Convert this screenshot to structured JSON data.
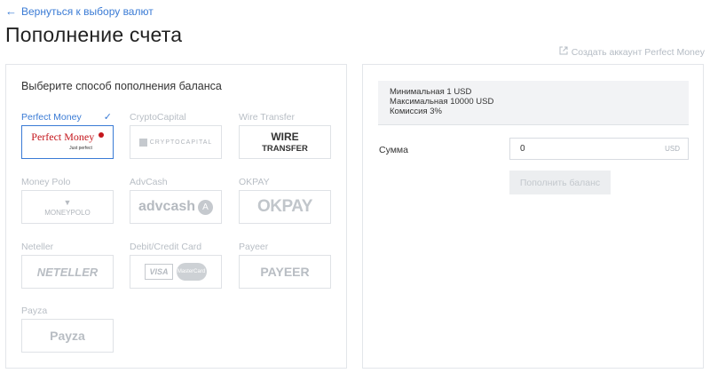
{
  "header": {
    "back_label": "Вернуться к выбору валют",
    "title": "Пополнение счета",
    "create_account_label": "Создать аккаунт Perfect Money"
  },
  "methods_panel": {
    "heading": "Выберите способ пополнения баланса",
    "methods": [
      {
        "label": "Perfect Money",
        "logo_text": "Perfect Money",
        "logo_sub": "Just perfect",
        "selected": true,
        "icon": "check-icon"
      },
      {
        "label": "CryptoCapital",
        "logo_text": "CRYPTOCAPITAL",
        "selected": false
      },
      {
        "label": "Wire Transfer",
        "logo_text": "WIRE",
        "logo_sub": "TRANSFER",
        "selected": false
      },
      {
        "label": "Money Polo",
        "logo_text": "MONEYPOLO",
        "selected": false
      },
      {
        "label": "AdvCash",
        "logo_text": "advcash",
        "selected": false
      },
      {
        "label": "OKPAY",
        "logo_text": "OKPAY",
        "selected": false
      },
      {
        "label": "Neteller",
        "logo_text": "NETELLER",
        "selected": false
      },
      {
        "label": "Debit/Credit Card",
        "logo_text": "VISA",
        "logo_sub": "MasterCard",
        "selected": false
      },
      {
        "label": "Payeer",
        "logo_text": "PAYEER",
        "selected": false
      },
      {
        "label": "Payza",
        "logo_text": "Payza",
        "selected": false
      }
    ]
  },
  "deposit_panel": {
    "info": {
      "min": "Минимальная 1 USD",
      "max": "Максимальная 10000 USD",
      "fee": "Комиссия 3%"
    },
    "amount_label": "Сумма",
    "amount_value": "0",
    "currency": "USD",
    "submit_label": "Пополнить баланс"
  },
  "colors": {
    "accent": "#3a7bd5",
    "muted": "#b8bec5",
    "perfect_money_red": "#c4161c"
  }
}
